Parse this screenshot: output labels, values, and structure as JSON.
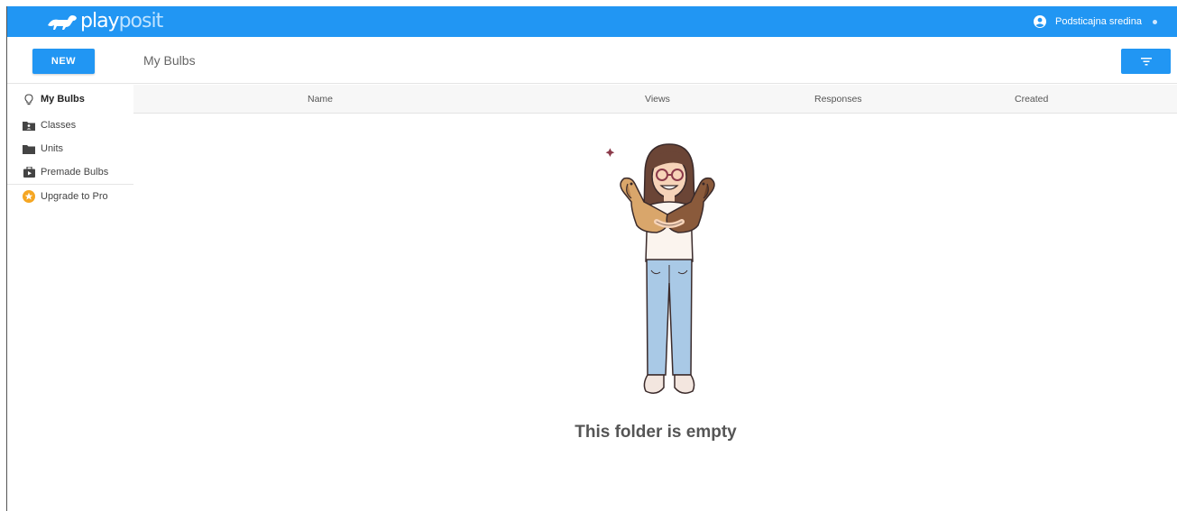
{
  "app": {
    "logo_text_a": "play",
    "logo_text_b": "posit",
    "brand_color": "#2196f3",
    "user_name": "Podsticajna sredina"
  },
  "toolbar": {
    "new_label": "NEW",
    "title": "My Bulbs",
    "filter_icon": "filter-icon"
  },
  "sidebar": {
    "items": [
      {
        "label": "My Bulbs",
        "icon": "lightbulb-icon"
      },
      {
        "label": "Classes",
        "icon": "class-folder-icon"
      },
      {
        "label": "Units",
        "icon": "folder-icon"
      },
      {
        "label": "Premade Bulbs",
        "icon": "premade-icon"
      },
      {
        "label": "Upgrade to Pro",
        "icon": "star-icon"
      }
    ]
  },
  "table": {
    "columns": [
      "Name",
      "Views",
      "Responses",
      "Created"
    ]
  },
  "empty": {
    "message": "This folder is empty"
  }
}
